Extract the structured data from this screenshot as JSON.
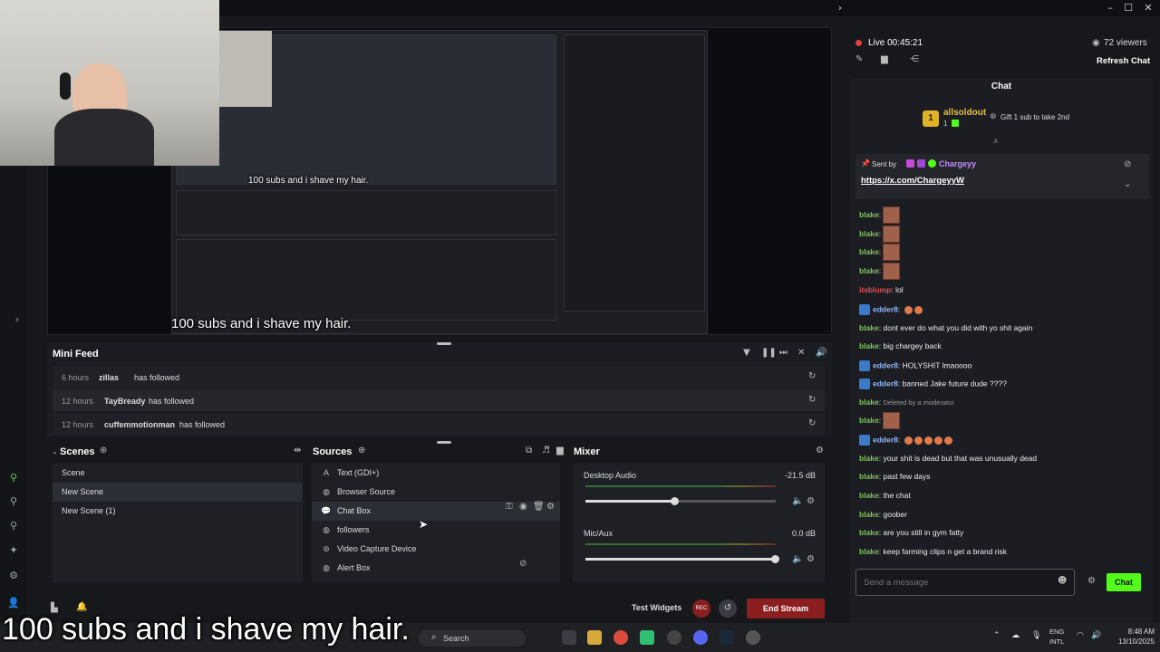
{
  "preview": {
    "caption_small": "100 subs and i shave my hair.",
    "caption_main": "100 subs and i shave my hair."
  },
  "mini_feed": {
    "title": "Mini Feed",
    "rows": [
      {
        "time": "6 hours",
        "user": "zillas",
        "action": "has followed"
      },
      {
        "time": "12 hours",
        "user": "TayBready",
        "action": "has followed"
      },
      {
        "time": "12 hours",
        "user": "cuffemmotionman",
        "action": "has followed"
      }
    ]
  },
  "scenes": {
    "title": "Scenes",
    "items": [
      {
        "label": "Scene",
        "selected": false
      },
      {
        "label": "New Scene",
        "selected": true
      },
      {
        "label": "New Scene (1)",
        "selected": false
      }
    ]
  },
  "sources": {
    "title": "Sources",
    "items": [
      {
        "label": "Text (GDI+)",
        "icon": "text-icon"
      },
      {
        "label": "Browser Source",
        "icon": "globe-icon"
      },
      {
        "label": "Chat Box",
        "icon": "chat-icon",
        "selected": true
      },
      {
        "label": "followers",
        "icon": "globe-icon"
      },
      {
        "label": "Video Capture Device",
        "icon": "camera-icon"
      },
      {
        "label": "Alert Box",
        "icon": "globe-icon"
      }
    ]
  },
  "mixer": {
    "title": "Mixer",
    "channels": [
      {
        "name": "Desktop Audio",
        "db": "-21.5 dB",
        "level": 0.47
      },
      {
        "name": "Mic/Aux",
        "db": "0.0 dB",
        "level": 1.0
      }
    ]
  },
  "footer": {
    "test_widgets": "Test Widgets",
    "rec": "REC",
    "end_stream": "End Stream"
  },
  "chat_header": {
    "live": "Live 00:45:21",
    "viewers": "72 viewers",
    "refresh": "Refresh Chat",
    "title": "Chat"
  },
  "hype": {
    "rank": "1",
    "user": "allsoldout",
    "count": "1",
    "gift_text": "Gift 1 sub to take 2nd"
  },
  "pinned": {
    "sent_by": "Sent by",
    "user": "Chargeyy",
    "link": "https://x.com/ChargeyyW"
  },
  "chat": [
    {
      "user": "blake",
      "text": "",
      "emote": true,
      "color": "#7ec45a"
    },
    {
      "user": "blake",
      "text": "",
      "emote": true,
      "color": "#7ec45a"
    },
    {
      "user": "blake",
      "text": "",
      "emote": true,
      "color": "#7ec45a"
    },
    {
      "user": "blake",
      "text": "",
      "emote": true,
      "color": "#7ec45a"
    },
    {
      "user": "itsblump",
      "text": "lol",
      "color": "#e05252"
    },
    {
      "user": "edder8",
      "text": "",
      "emojis": 2,
      "color": "#8fb8ff",
      "badge": true
    },
    {
      "user": "blake",
      "text": "dont ever do what you did with yo shit again",
      "color": "#7ec45a"
    },
    {
      "user": "blake",
      "text": "big chargey back",
      "color": "#7ec45a"
    },
    {
      "user": "edder8",
      "text": "HOLYSHIT lmaoooo",
      "color": "#8fb8ff",
      "badge": true
    },
    {
      "user": "edder8",
      "text": "banned Jake future dude ????",
      "color": "#8fb8ff",
      "badge": true
    },
    {
      "user": "blake",
      "text": "Deleted by a moderator",
      "color": "#7ec45a",
      "deleted": true
    },
    {
      "user": "blake",
      "text": "",
      "emote": true,
      "color": "#7ec45a"
    },
    {
      "user": "edder8",
      "text": "",
      "emojis": 5,
      "color": "#8fb8ff",
      "badge": true
    },
    {
      "user": "blake",
      "text": "your shit is dead but that was unusually dead",
      "color": "#7ec45a"
    },
    {
      "user": "blake",
      "text": "past few days",
      "color": "#7ec45a"
    },
    {
      "user": "blake",
      "text": "the chat",
      "color": "#7ec45a"
    },
    {
      "user": "blake",
      "text": "goober",
      "color": "#7ec45a"
    },
    {
      "user": "blake",
      "text": "are you still in gym fatty",
      "color": "#7ec45a"
    },
    {
      "user": "blake",
      "text": "keep farming clips n get a brand risk",
      "color": "#7ec45a"
    }
  ],
  "chat_input": {
    "placeholder": "Send a message",
    "send": "Chat"
  },
  "taskbar": {
    "search": "Search",
    "lang1": "ENG",
    "lang2": "INTL",
    "time": "8:48 AM",
    "date": "13/10/2025"
  },
  "colors": {
    "accent_green": "#53fc18",
    "end_stream_red": "#8b1e1e",
    "live_red": "#e0443a"
  }
}
